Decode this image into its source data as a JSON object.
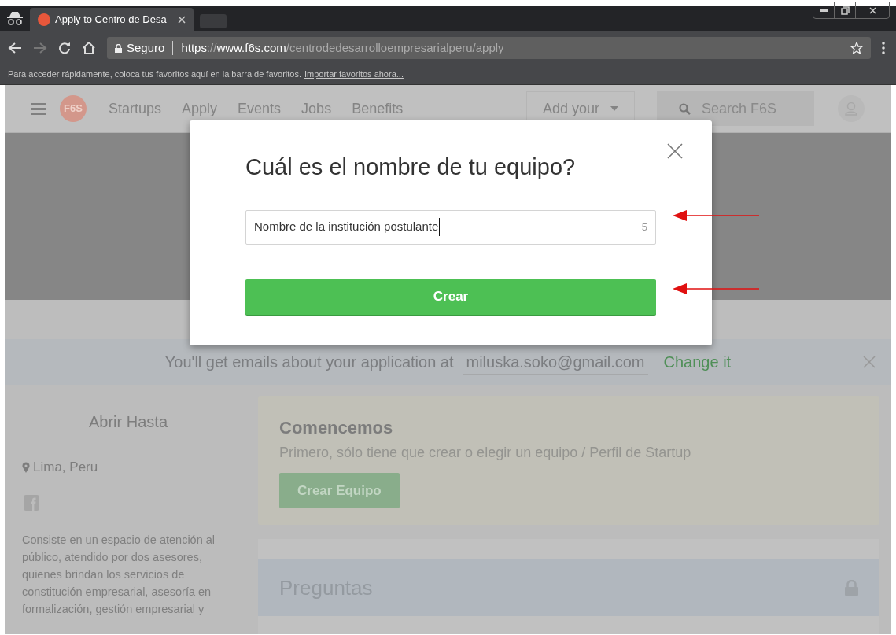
{
  "browser": {
    "tab_title": "Apply to Centro de Desa",
    "security_label": "Seguro",
    "url_scheme": "https",
    "url_sep": "://",
    "url_host": "www.f6s.com",
    "url_path": "/centrodedesarrolloempresarialperu/apply",
    "bookmarks_hint": "Para acceder rápidamente, coloca tus favoritos aquí en la barra de favoritos.",
    "bookmarks_link": "Importar favoritos ahora..."
  },
  "nav": {
    "logo": "F6S",
    "items": [
      "Startups",
      "Apply",
      "Events",
      "Jobs",
      "Benefits"
    ],
    "add_button": "Add your",
    "search_placeholder": "Search F6S"
  },
  "email_bar": {
    "text": "You'll get emails about your application at",
    "email": "miluska.soko@gmail.com",
    "link": "Change it"
  },
  "sidebar": {
    "heading": "Abrir Hasta",
    "location": "Lima, Peru",
    "description": "Consiste en un espacio de atención al público, atendido por dos asesores, quienes brindan los servicios de constitución empresarial, asesoría en formalización, gestión empresarial y"
  },
  "start_card": {
    "title": "Comencemos",
    "subtitle": "Primero, sólo tiene que crear o elegir un equipo / Perfil de Startup",
    "button": "Crear Equipo"
  },
  "questions": {
    "title": "Preguntas",
    "locked": true
  },
  "modal": {
    "title": "Cuál es el nombre de tu equipo?",
    "input_value": "Nombre de la institución postulante",
    "char_count": "5",
    "submit": "Crear"
  }
}
